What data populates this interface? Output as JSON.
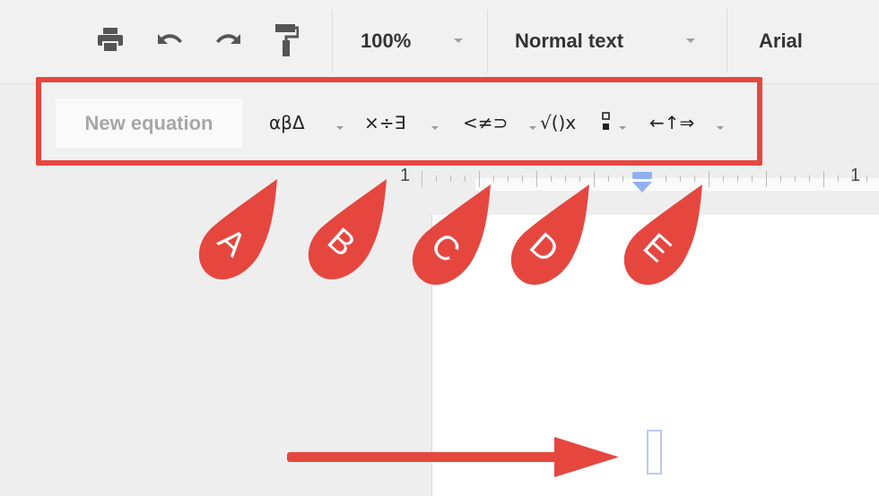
{
  "toolbar": {
    "print_icon": "printer-icon",
    "undo_icon": "undo-icon",
    "redo_icon": "redo-icon",
    "paint_format_icon": "paint-roller-icon",
    "zoom": "100%",
    "style": "Normal text",
    "font": "Arial"
  },
  "equation_toolbar": {
    "new_equation": "New equation",
    "groups": [
      {
        "symbols": "αβΔ"
      },
      {
        "symbols": "×÷∃"
      },
      {
        "symbols": "<≠⊃"
      },
      {
        "symbols": "√()x"
      },
      {
        "symbols": "←↑⇒"
      }
    ]
  },
  "ruler": {
    "left_number": "1",
    "right_number": "1"
  },
  "callouts": [
    "A",
    "B",
    "C",
    "D",
    "E"
  ],
  "colors": {
    "callout": "#e5473f",
    "toolbar_bg": "#f1f1f1",
    "cursor": "#b9c9ee"
  }
}
